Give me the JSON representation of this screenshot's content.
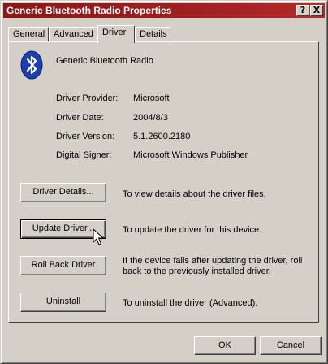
{
  "window": {
    "title": "Generic Bluetooth Radio Properties",
    "help_glyph": "?",
    "close_glyph": "X",
    "icons": {
      "help": "help-icon",
      "close": "close-icon"
    }
  },
  "tabs": [
    {
      "label": "General"
    },
    {
      "label": "Advanced"
    },
    {
      "label": "Driver",
      "active": true
    },
    {
      "label": "Details"
    }
  ],
  "device": {
    "name": "Generic Bluetooth Radio",
    "icon": "bluetooth-icon",
    "icon_color": "#1a3fb0"
  },
  "info": [
    {
      "label": "Driver Provider:",
      "value": "Microsoft"
    },
    {
      "label": "Driver Date:",
      "value": "2004/8/3"
    },
    {
      "label": "Driver Version:",
      "value": "5.1.2600.2180"
    },
    {
      "label": "Digital Signer:",
      "value": "Microsoft Windows Publisher"
    }
  ],
  "actions": [
    {
      "button": "Driver Details...",
      "description": "To view details about the driver files."
    },
    {
      "button": "Update Driver...",
      "description": "To update the driver for this device."
    },
    {
      "button": "Roll Back Driver",
      "description_line1": "If the device fails after updating the driver, roll",
      "description_line2": "back to the previously installed driver."
    },
    {
      "button": "Uninstall",
      "description": "To uninstall the driver (Advanced)."
    }
  ],
  "footer": {
    "ok": "OK",
    "cancel": "Cancel"
  },
  "colors": {
    "titlebar": "#a02020",
    "face": "#d4d0c8"
  }
}
